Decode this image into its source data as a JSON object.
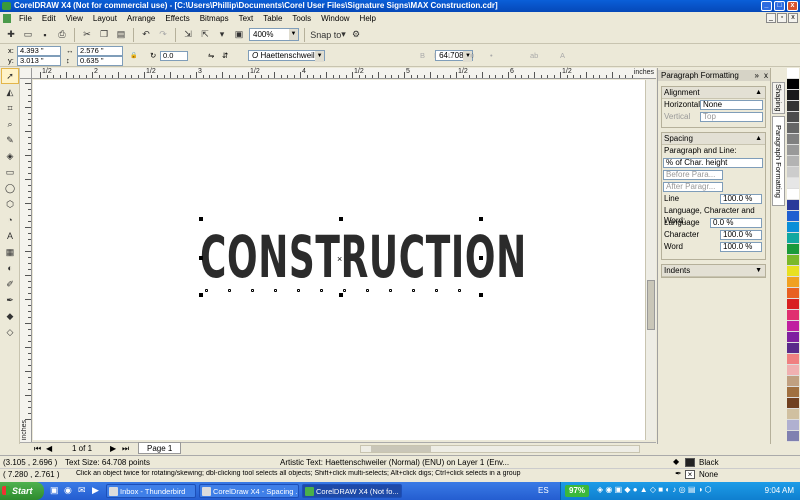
{
  "window": {
    "title": "CorelDRAW X4 (Not for commercial use) - [C:\\Users\\Phillip\\Documents\\Corel User Files\\Signature Signs\\MAX Construction.cdr]",
    "min": "_",
    "max": "□",
    "close": "x"
  },
  "menu": [
    "File",
    "Edit",
    "View",
    "Layout",
    "Arrange",
    "Effects",
    "Bitmaps",
    "Text",
    "Table",
    "Tools",
    "Window",
    "Help"
  ],
  "toolbar": {
    "zoom": "400%",
    "snap_to": "Snap to"
  },
  "props": {
    "x_label": "x:",
    "x": "4.393 \"",
    "y_label": "y:",
    "y": "3.013 \"",
    "w": "2.576 \"",
    "h": "0.635 \"",
    "rotation": "0.0",
    "font": "Haettenschweiler",
    "font_size": "64.708 pt"
  },
  "ruler": {
    "units": "inches",
    "side_units": "inches",
    "h_labels": [
      "1/2",
      "2",
      "1/2",
      "3",
      "1/2",
      "4",
      "1/2",
      "5",
      "1/2",
      "6",
      "1/2"
    ]
  },
  "canvas": {
    "text": "CONSTRUCTION"
  },
  "pager": {
    "count": "1 of 1",
    "tab": "Page 1"
  },
  "docker": {
    "title": "Paragraph Formatting",
    "alignment": {
      "header": "Alignment",
      "horizontal_label": "Horizontal",
      "horizontal": "None",
      "vertical_label": "Vertical",
      "vertical": "Top"
    },
    "spacing": {
      "header": "Spacing",
      "para_line": "Paragraph and Line:",
      "mode": "% of Char. height",
      "before": "Before Para...",
      "after": "After Paragr...",
      "line_label": "Line",
      "line": "100.0 %",
      "lcw": "Language, Character and Word:",
      "language_label": "Language",
      "language": "0.0 %",
      "character_label": "Character",
      "character": "100.0 %",
      "word_label": "Word",
      "word": "100.0 %"
    },
    "indents": {
      "header": "Indents"
    },
    "tabs": [
      "Shaping",
      "Paragraph Formatting"
    ]
  },
  "palette": [
    "#ffffff",
    "#000000",
    "#1a1a1a",
    "#333333",
    "#4d4d4d",
    "#666666",
    "#808080",
    "#999999",
    "#b3b3b3",
    "#cccccc",
    "#e6e6e6",
    "#ffffff",
    "#2a3a9a",
    "#1f5fd0",
    "#0a8fd8",
    "#11a8a0",
    "#1a9a3a",
    "#7ab82a",
    "#e8e020",
    "#f0a020",
    "#e86020",
    "#d82020",
    "#e03070",
    "#c020a0",
    "#8020a0",
    "#5a2a8a",
    "#f08080",
    "#f0b0b0",
    "#c0a080",
    "#a07040",
    "#704020",
    "#d0c0a0",
    "#b0b0d0",
    "#8080b0"
  ],
  "status": {
    "coords": "(3.105 , 2.696 )",
    "text_size": "Text Size: 64.708 points",
    "object_info": "Artistic Text: Haettenschweiler (Normal) (ENU) on Layer 1  (Env...",
    "cursor": "( 7.280 , 2.761 )",
    "hint": "Click an object twice for rotating/skewing; dbl-clicking tool selects all objects; Shift+click multi-selects; Alt+click digs; Ctrl+click selects in a group",
    "fill_label": "Black",
    "outline_label": "None",
    "fill_color": "#222222"
  },
  "taskbar": {
    "start": "Start",
    "tasks": [
      "Inbox - Thunderbird",
      "CorelDraw X4 - Spacing ...",
      "CorelDRAW X4 (Not fo..."
    ],
    "lang": "ES",
    "battery": "97%",
    "time": "9:04 AM"
  }
}
